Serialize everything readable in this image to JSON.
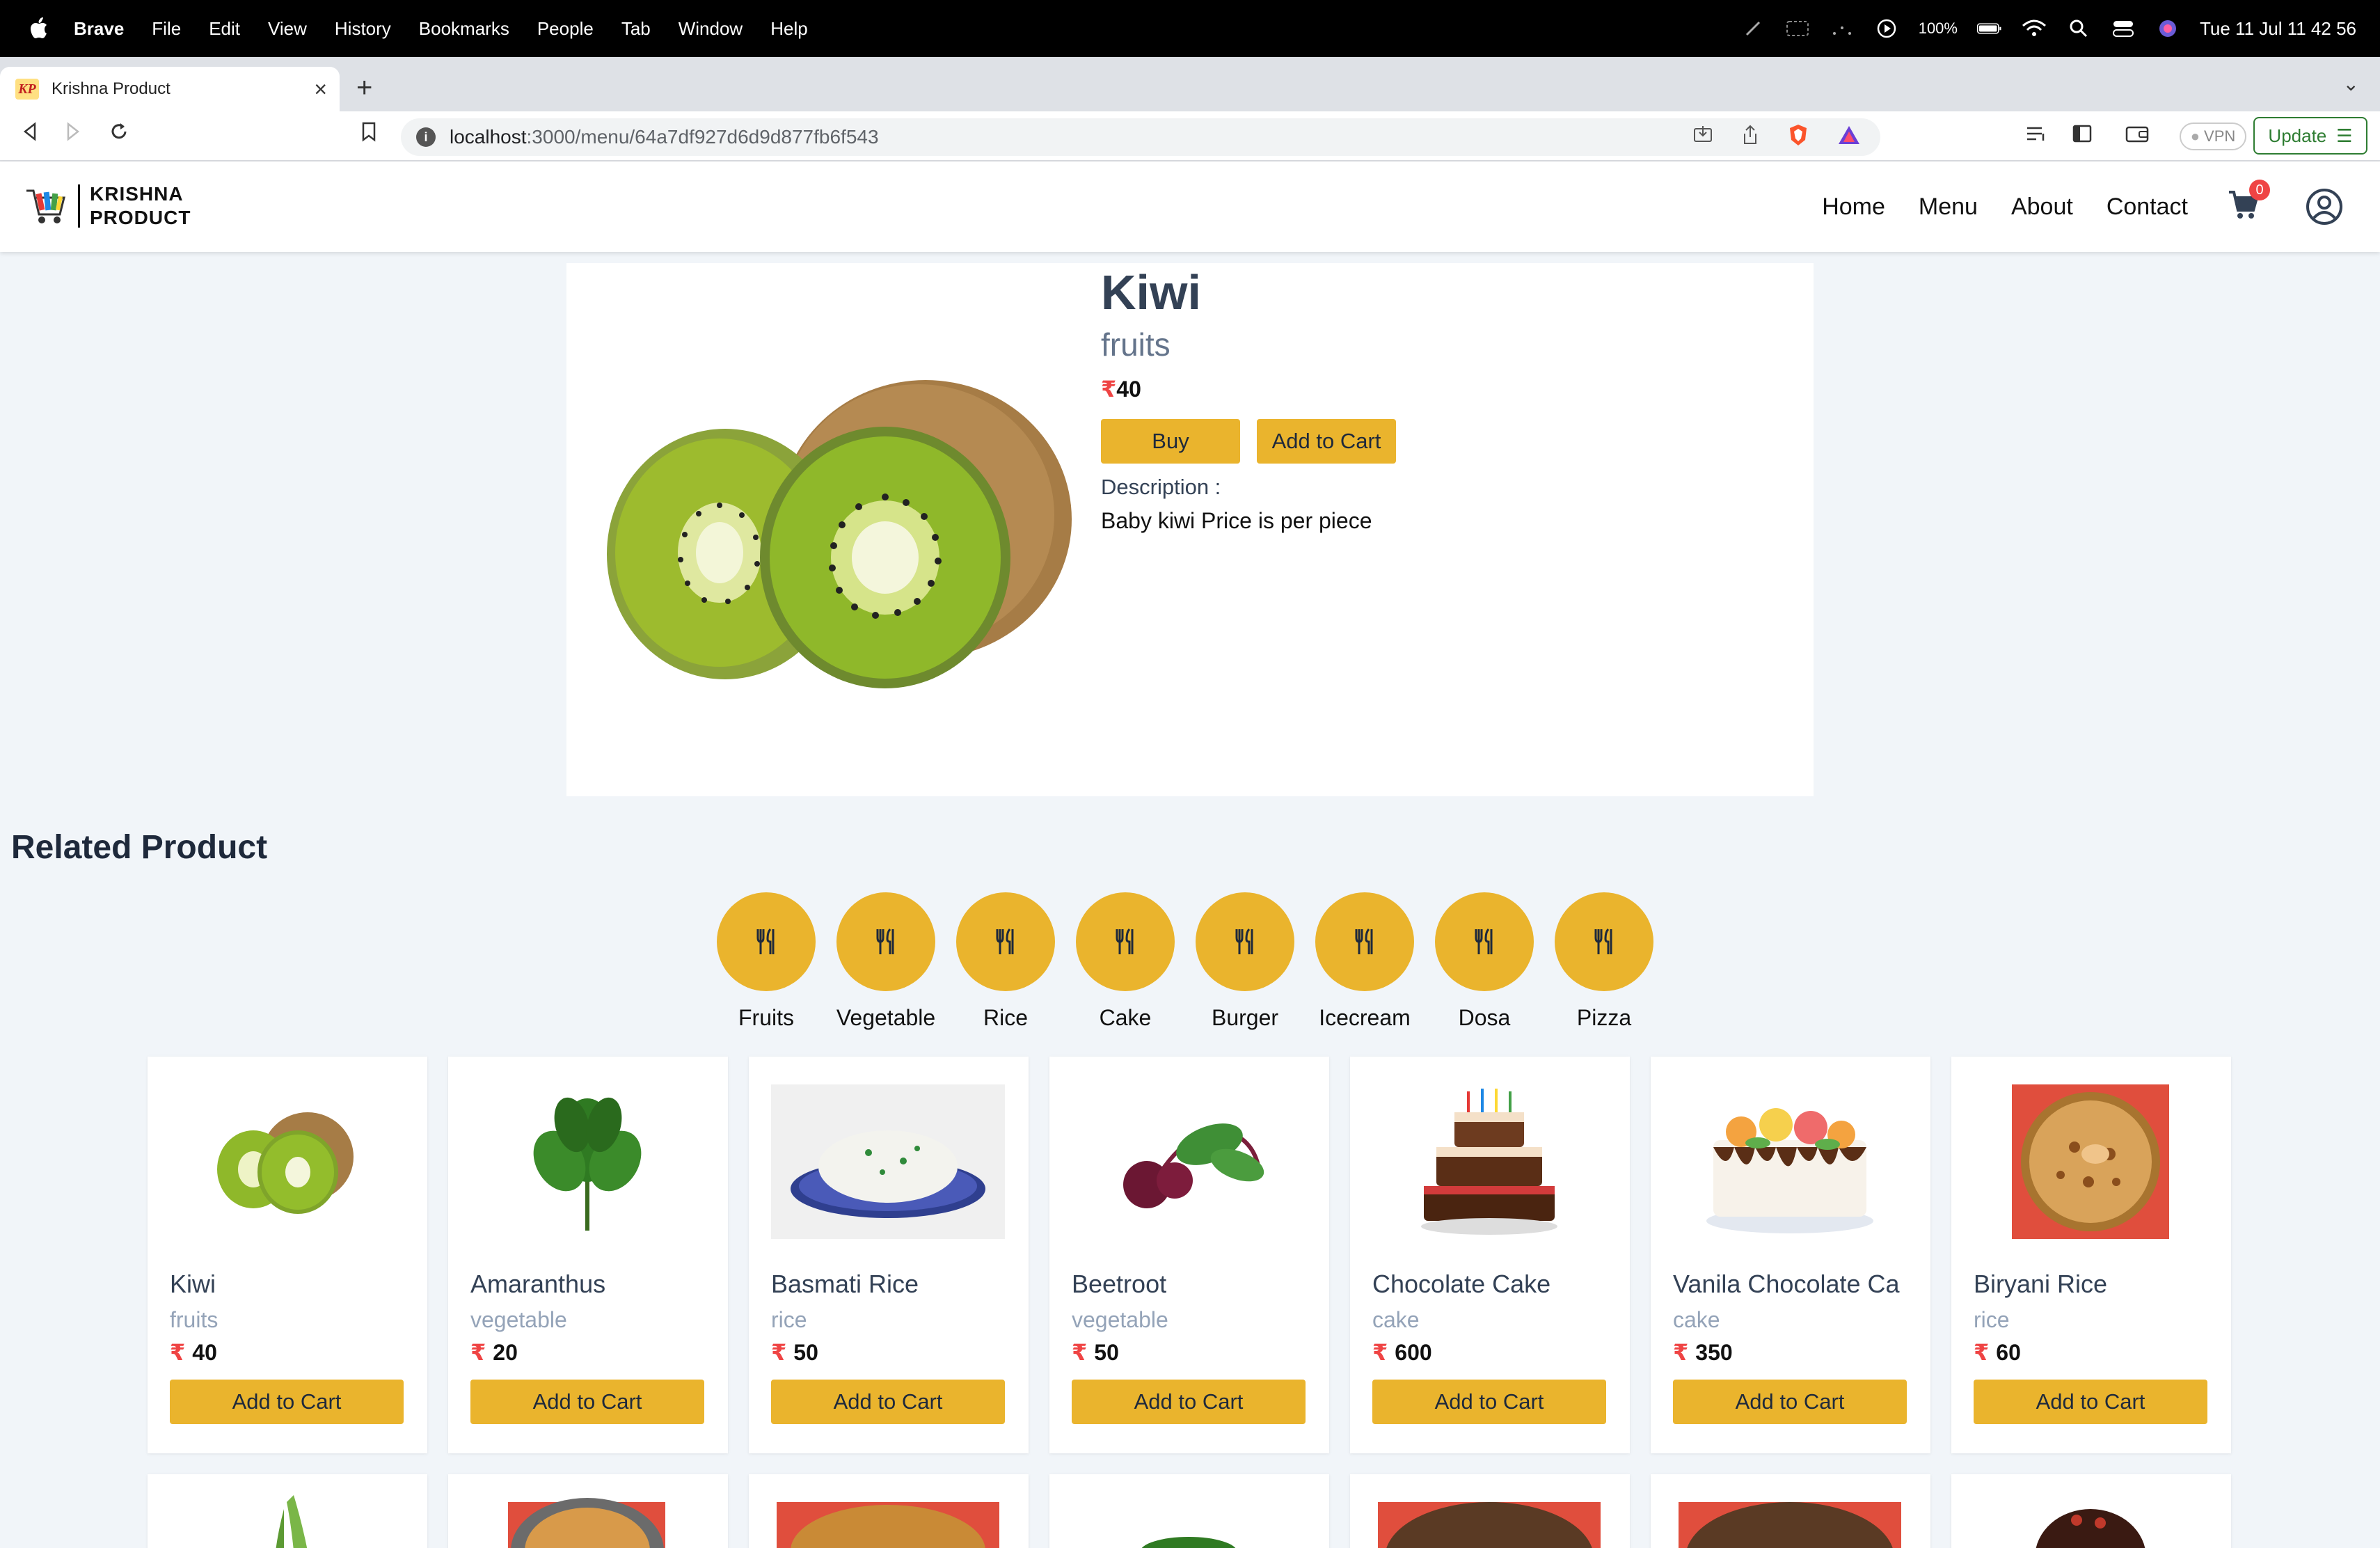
{
  "menubar": {
    "app": "Brave",
    "items": [
      "File",
      "Edit",
      "View",
      "History",
      "Bookmarks",
      "People",
      "Tab",
      "Window",
      "Help"
    ],
    "battery": "100%",
    "datetime": "Tue 11 Jul  11 42 56"
  },
  "browser": {
    "tab_title": "Krishna Product",
    "tab_favicon": "KP",
    "url_host": "localhost",
    "url_path": ":3000/menu/64a7df927d6d9d877fb6f543",
    "vpn_label": "VPN",
    "update_label": "Update"
  },
  "site": {
    "brand_line1": "KRISHNA",
    "brand_line2": "PRODUCT",
    "nav": [
      "Home",
      "Menu",
      "About",
      "Contact"
    ],
    "cart_count": "0"
  },
  "product": {
    "name": "Kiwi",
    "category": "fruits",
    "currency": "₹",
    "price": "40",
    "buy_label": "Buy",
    "add_label": "Add to Cart",
    "desc_label": "Description :",
    "description": "Baby kiwi Price is per piece"
  },
  "related": {
    "title": "Related Product",
    "categories": [
      "Fruits",
      "Vegetable",
      "Rice",
      "Cake",
      "Burger",
      "Icecream",
      "Dosa",
      "Pizza"
    ],
    "cards": [
      {
        "name": "Kiwi",
        "category": "fruits",
        "price": "40",
        "button": "Add to Cart"
      },
      {
        "name": "Amaranthus",
        "category": "vegetable",
        "price": "20",
        "button": "Add to Cart"
      },
      {
        "name": "Basmati Rice",
        "category": "rice",
        "price": "50",
        "button": "Add to Cart"
      },
      {
        "name": "Beetroot",
        "category": "vegetable",
        "price": "50",
        "button": "Add to Cart"
      },
      {
        "name": "Chocolate Cake",
        "category": "cake",
        "price": "600",
        "button": "Add to Cart"
      },
      {
        "name": "Vanila Chocolate Ca",
        "category": "cake",
        "price": "350",
        "button": "Add to Cart"
      },
      {
        "name": "Biryani Rice",
        "category": "rice",
        "price": "60",
        "button": "Add to Cart"
      }
    ]
  },
  "colors": {
    "accent": "#eab42d",
    "price_symbol": "#ef4444",
    "page_bg": "#f1f5f9"
  }
}
